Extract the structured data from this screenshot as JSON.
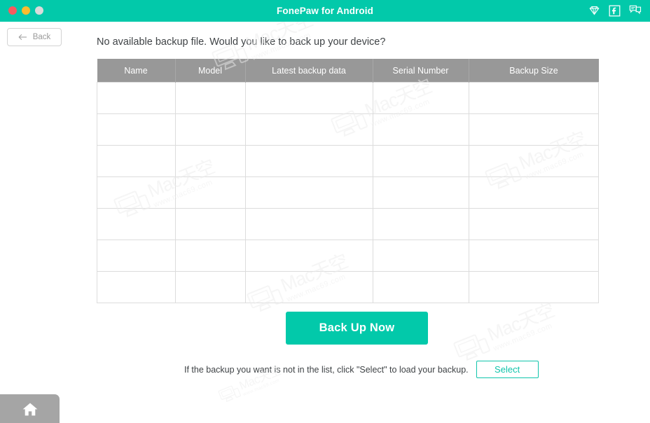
{
  "window": {
    "title": "FonePaw for Android",
    "traffic_lights": [
      "close",
      "minimize",
      "zoom"
    ],
    "accent_color": "#02c9aa",
    "header_gray": "#989898",
    "icons": [
      {
        "name": "diamond-icon",
        "label": "Upgrade"
      },
      {
        "name": "facebook-icon",
        "label": "Facebook"
      },
      {
        "name": "feedback-icon",
        "label": "Feedback"
      }
    ]
  },
  "nav": {
    "back_label": "Back",
    "back_icon": "arrow-left-icon"
  },
  "main": {
    "headline": "No available backup file. Would you like to back up your device?",
    "table": {
      "columns": [
        "Name",
        "Model",
        "Latest backup data",
        "Serial Number",
        "Backup Size"
      ],
      "rows": [
        [
          "",
          "",
          "",
          "",
          ""
        ],
        [
          "",
          "",
          "",
          "",
          ""
        ],
        [
          "",
          "",
          "",
          "",
          ""
        ],
        [
          "",
          "",
          "",
          "",
          ""
        ],
        [
          "",
          "",
          "",
          "",
          ""
        ],
        [
          "",
          "",
          "",
          "",
          ""
        ],
        [
          "",
          "",
          "",
          "",
          ""
        ]
      ],
      "row_count": 7,
      "empty": true
    },
    "primary_button": "Back Up Now",
    "hint_text": "If the backup you want is not in the list, click \"Select\" to load your backup.",
    "select_button": "Select"
  },
  "footer": {
    "home_tab_icon": "home-icon"
  },
  "watermarks": {
    "brand": "Mac天空",
    "url": "www.mac69.com"
  }
}
